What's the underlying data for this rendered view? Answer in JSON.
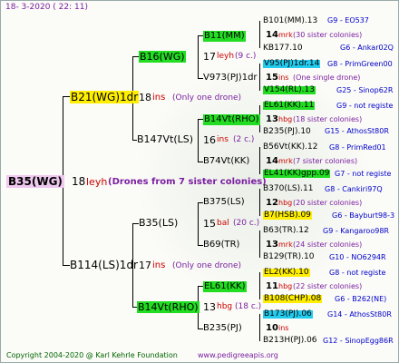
{
  "header": {
    "date": "18-  3-2020 (  22: 11)"
  },
  "footer": {
    "copyright": "Copyright 2004-2020 @ Karl Kehrle Foundation",
    "url": "www.pedigreeapis.org"
  },
  "root": {
    "label": "B35(WG)",
    "num": "18",
    "breed": "leyh",
    "note": "(Drones from 7 sister colonies)"
  },
  "sire": {
    "label": "B21(WG)1dr",
    "num": "18",
    "breed": "ins",
    "note": "(Only one drone)"
  },
  "dam": {
    "label": "B114(LS)1dr",
    "num": "17",
    "breed": "ins",
    "note": "(Only one drone)"
  },
  "ss": {
    "label": "B16(WG)",
    "num": "17",
    "breed": "leyh",
    "note": "(9 c.)"
  },
  "sd": {
    "label": "B147Vt(LS)",
    "num": "16",
    "breed": "ins",
    "note": "(2 c.)"
  },
  "ds": {
    "label": "B35(LS)",
    "num": "15",
    "breed": "bal",
    "note": "(20 c.)"
  },
  "dd": {
    "label": "B14Vt(RHO)",
    "num": "13",
    "breed": "hbg",
    "note": "(18 c.)"
  },
  "gen3": {
    "a": "B11(MM)",
    "b": "V973(PJ)1dr",
    "c": "B14Vt(RHO)",
    "d": "B74Vt(KK)",
    "e": "B375(LS)",
    "f": "B69(TR)",
    "g": "EL61(KK)",
    "h": "B235(PJ)"
  },
  "gen3notes": {
    "a": {
      "num": "14",
      "breed": "mrk",
      "note": "(30 sister colonies)"
    },
    "b": {
      "num": "15",
      "breed": "ins",
      "note": "(One single drone)"
    },
    "c": {
      "num": "13",
      "breed": "hbg",
      "note": "(18 sister colonies)"
    },
    "d": {
      "num": "14",
      "breed": "mrk",
      "note": "(7 sister colonies)"
    },
    "e": {
      "num": "12",
      "breed": "hbg",
      "note": "(20 sister colonies)"
    },
    "f": {
      "num": "13",
      "breed": "mrk",
      "note": "(24 sister colonies)"
    },
    "g": {
      "num": "11",
      "breed": "hbg",
      "note": "(22 sister colonies)"
    },
    "h": {
      "num": "10",
      "breed": "ins",
      "note": ""
    }
  },
  "gen4": [
    {
      "name": "B101(MM).13",
      "info": "G9 - EO537"
    },
    {
      "name": "KB177.10",
      "info": "G6 - Ankar02Q"
    },
    {
      "name": "V95(PJ)1dr.14",
      "info": "G8 - PrimGreen00"
    },
    {
      "name": "V154(RL).13",
      "info": "G25 - Sinop62R"
    },
    {
      "name": "EL61(KK).11",
      "info": "G9 - not registe"
    },
    {
      "name": "B235(PJ).10",
      "info": "G15 - AthosSt80R"
    },
    {
      "name": "B56Vt(KK).12",
      "info": "G8 - PrimRed01"
    },
    {
      "name": "EL41(KK)gpp.09",
      "info": "G7 - not registe"
    },
    {
      "name": "B370(LS).11",
      "info": "G8 - Cankiri97Q"
    },
    {
      "name": "B7(HSB).09",
      "info": "G6 - Bayburt98-3"
    },
    {
      "name": "B63(TR).12",
      "info": "G9 - Kangaroo98R"
    },
    {
      "name": "B129(TR).10",
      "info": "G10 - NO6294R"
    },
    {
      "name": "EL2(KK).10",
      "info": "G8 - not registe"
    },
    {
      "name": "B108(CHP).08",
      "info": "G6 - B262(NE)"
    },
    {
      "name": "B173(PJ).06",
      "info": "G14 - AthosSt80R"
    },
    {
      "name": "B213H(PJ).06",
      "info": "G12 - SinopEgg86R"
    }
  ]
}
